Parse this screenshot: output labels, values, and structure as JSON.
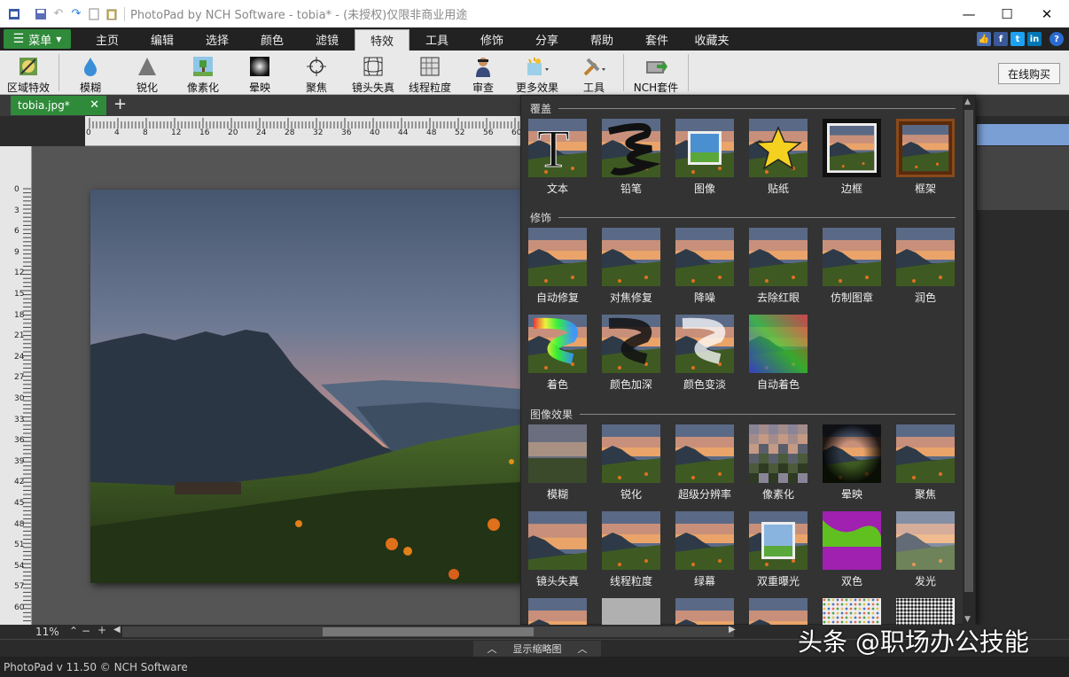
{
  "window": {
    "title": "PhotoPad by NCH Software - tobia* - (未授权)仅限非商业用途",
    "controls": [
      "—",
      "☐",
      "✕"
    ]
  },
  "menu": {
    "main_button": "菜单",
    "tabs": [
      "主页",
      "编辑",
      "选择",
      "颜色",
      "滤镜",
      "特效",
      "工具",
      "修饰",
      "分享",
      "帮助",
      "套件",
      "收藏夹"
    ],
    "active_tab": "特效",
    "social": [
      {
        "name": "like-icon",
        "glyph": "👍",
        "color": "#4a6fb5"
      },
      {
        "name": "facebook-icon",
        "glyph": "f",
        "color": "#3b5998"
      },
      {
        "name": "twitter-icon",
        "glyph": "t",
        "color": "#1da1f2"
      },
      {
        "name": "linkedin-icon",
        "glyph": "in",
        "color": "#0077b5"
      },
      {
        "name": "help-icon",
        "glyph": "?",
        "color": "#2a6bd1"
      }
    ]
  },
  "toolbar": {
    "buttons": [
      {
        "name": "regional-effects",
        "label": "区域特效",
        "icon": "brush-icon"
      },
      {
        "name": "blur",
        "label": "模糊",
        "icon": "drop-icon"
      },
      {
        "name": "sharpen",
        "label": "锐化",
        "icon": "triangle-icon"
      },
      {
        "name": "pixelate",
        "label": "像素化",
        "icon": "pixel-tree-icon"
      },
      {
        "name": "vignette",
        "label": "晕映",
        "icon": "vignette-icon"
      },
      {
        "name": "focus",
        "label": "聚焦",
        "icon": "crosshair-icon"
      },
      {
        "name": "lens-distortion",
        "label": "镜头失真",
        "icon": "grid-icon"
      },
      {
        "name": "film-grain",
        "label": "线程粒度",
        "icon": "grain-icon"
      },
      {
        "name": "review",
        "label": "审查",
        "icon": "person-icon"
      },
      {
        "name": "more-effects",
        "label": "更多效果",
        "icon": "wand-icon"
      },
      {
        "name": "tools",
        "label": "工具",
        "icon": "tools-icon"
      },
      {
        "name": "nch-suite",
        "label": "NCH套件",
        "icon": "suite-icon"
      }
    ],
    "buy_online": "在线购买"
  },
  "document": {
    "tab_name": "tobia.jpg*",
    "close": "✕",
    "add": "+"
  },
  "ruler": {
    "top_labels": [
      "0",
      "4",
      "8",
      "12",
      "16",
      "20",
      "24",
      "28",
      "32",
      "36",
      "40",
      "44",
      "48",
      "52",
      "56",
      "60"
    ],
    "left_labels": [
      "0",
      "3",
      "6",
      "9",
      "12",
      "15",
      "18",
      "21",
      "24",
      "27",
      "30",
      "33",
      "36",
      "39",
      "42",
      "45",
      "48",
      "51",
      "54",
      "57",
      "60"
    ]
  },
  "effects_panel": {
    "sections": [
      {
        "title": "覆盖",
        "items": [
          {
            "label": "文本",
            "thumb": "text"
          },
          {
            "label": "铅笔",
            "thumb": "pencil"
          },
          {
            "label": "图像",
            "thumb": "image"
          },
          {
            "label": "贴纸",
            "thumb": "sticker"
          },
          {
            "label": "边框",
            "thumb": "border"
          },
          {
            "label": "框架",
            "thumb": "frame"
          }
        ]
      },
      {
        "title": "修饰",
        "items": [
          {
            "label": "自动修复",
            "thumb": "landscape"
          },
          {
            "label": "对焦修复",
            "thumb": "landscape"
          },
          {
            "label": "降噪",
            "thumb": "landscape"
          },
          {
            "label": "去除红眼",
            "thumb": "landscape"
          },
          {
            "label": "仿制图章",
            "thumb": "landscape"
          },
          {
            "label": "润色",
            "thumb": "landscape"
          },
          {
            "label": "着色",
            "thumb": "colorize"
          },
          {
            "label": "颜色加深",
            "thumb": "burn"
          },
          {
            "label": "颜色变淡",
            "thumb": "dodge"
          },
          {
            "label": "自动着色",
            "thumb": "autocolor"
          }
        ]
      },
      {
        "title": "图像效果",
        "items": [
          {
            "label": "模糊",
            "thumb": "blur"
          },
          {
            "label": "锐化",
            "thumb": "landscape"
          },
          {
            "label": "超级分辨率",
            "thumb": "landscape"
          },
          {
            "label": "像素化",
            "thumb": "pixelate"
          },
          {
            "label": "晕映",
            "thumb": "vignette"
          },
          {
            "label": "聚焦",
            "thumb": "landscape"
          },
          {
            "label": "镜头失真",
            "thumb": "lens"
          },
          {
            "label": "线程粒度",
            "thumb": "landscape"
          },
          {
            "label": "绿幕",
            "thumb": "landscape"
          },
          {
            "label": "双重曝光",
            "thumb": "double"
          },
          {
            "label": "双色",
            "thumb": "duotone"
          },
          {
            "label": "发光",
            "thumb": "glow"
          },
          {
            "label": "",
            "thumb": "landscape"
          },
          {
            "label": "",
            "thumb": "gray"
          },
          {
            "label": "",
            "thumb": "landscape"
          },
          {
            "label": "",
            "thumb": "landscape"
          },
          {
            "label": "",
            "thumb": "dots"
          },
          {
            "label": "",
            "thumb": "halftone"
          }
        ]
      }
    ]
  },
  "statusbar": {
    "zoom": "11%",
    "thumbnail_toggle": "显示缩略图",
    "version": "PhotoPad v 11.50 © NCH Software"
  },
  "watermark": "头条 @职场办公技能",
  "colors": {
    "accent_green": "#2f8a3a",
    "selection_blue": "#7a9fd4"
  }
}
